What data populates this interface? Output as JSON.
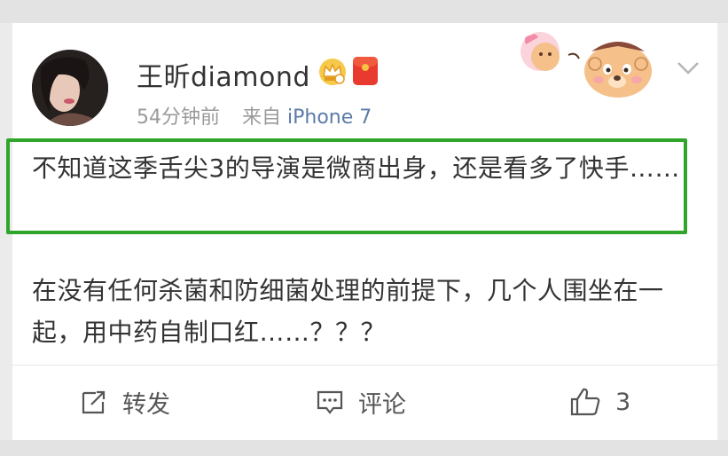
{
  "post": {
    "author": {
      "name": "王昕diamond"
    },
    "meta": {
      "time": "54分钟前",
      "source_prefix": "来自",
      "source": "iPhone 7"
    },
    "paragraphs": [
      "不知道这季舌尖3的导演是微商出身，还是看多了快手……",
      "在没有任何杀菌和防细菌处理的前提下，几个人围坐在一起，用中药自制口红……？？？"
    ],
    "highlight_color": "#2fa52b"
  },
  "actions": {
    "repost_label": "转发",
    "comment_label": "评论",
    "like_count": "3"
  },
  "icons": {
    "crown": "vip-crown-icon",
    "red_packet": "red-packet-icon",
    "chevron": "chevron-down-icon",
    "repost": "repost-icon",
    "comment": "comment-icon",
    "like": "thumbs-up-icon"
  }
}
